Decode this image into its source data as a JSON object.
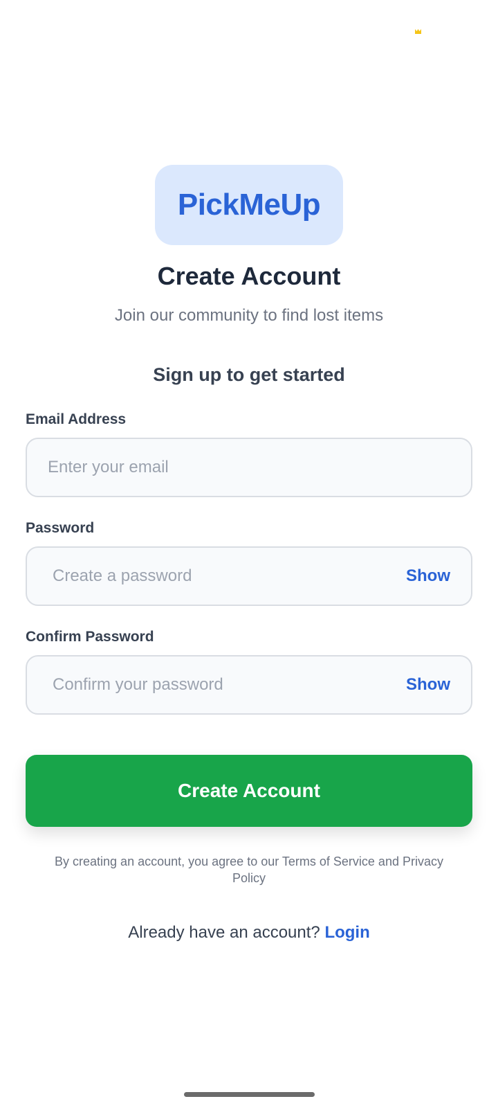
{
  "app": {
    "logo_text": "PickMeUp"
  },
  "header": {
    "title": "Create Account",
    "subtitle": "Join our community to find lost items",
    "section_heading": "Sign up to get started"
  },
  "form": {
    "email": {
      "label": "Email Address",
      "placeholder": "Enter your email",
      "value": ""
    },
    "password": {
      "label": "Password",
      "placeholder": "Create a password",
      "value": "",
      "toggle_label": "Show"
    },
    "confirm_password": {
      "label": "Confirm Password",
      "placeholder": "Confirm your password",
      "value": "",
      "toggle_label": "Show"
    },
    "submit_label": "Create Account",
    "terms_text": "By creating an account, you agree to our Terms of Service and Privacy Policy"
  },
  "footer": {
    "prompt": "Already have an account?",
    "login_label": "Login"
  },
  "colors": {
    "brand_blue": "#2a63d6",
    "logo_background": "#dbe8fd",
    "submit_green": "#18a54a",
    "status_icon_yellow": "#f5c518"
  },
  "icons": {
    "status_bar": "crown-icon"
  }
}
